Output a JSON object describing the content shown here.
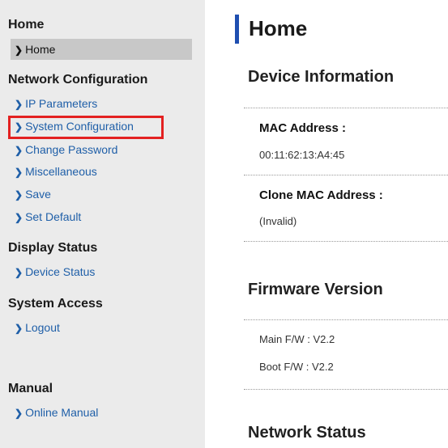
{
  "sidebar": {
    "sections": [
      {
        "title": "Home",
        "items": [
          {
            "label": "Home",
            "selected": true
          }
        ]
      },
      {
        "title": "Network Configuration",
        "items": [
          {
            "label": "IP Parameters"
          },
          {
            "label": "System Configuration",
            "highlighted": true
          },
          {
            "label": "Change Password"
          },
          {
            "label": "Miscellaneous"
          },
          {
            "label": "Save"
          },
          {
            "label": "Set Default"
          }
        ]
      },
      {
        "title": "Display Status",
        "items": [
          {
            "label": "Device Status"
          }
        ]
      },
      {
        "title": "System Access",
        "items": [
          {
            "label": "Logout"
          }
        ]
      },
      {
        "title": "Manual",
        "items": [
          {
            "label": "Online Manual"
          }
        ]
      }
    ]
  },
  "main": {
    "title": "Home",
    "device_info": {
      "heading": "Device Information",
      "mac_label": "MAC Address :",
      "mac_value": "00:11:62:13:A4:45",
      "clone_label": "Clone MAC Address :",
      "clone_value": "(Invalid)"
    },
    "firmware": {
      "heading": "Firmware Version",
      "main": "Main F/W : V2.2",
      "boot": "Boot F/W : V2.2"
    },
    "network": {
      "heading": "Network Status"
    }
  },
  "colors": {
    "link": "#1f5fa8",
    "highlight_box": "#e32121",
    "title_bar": "#1f4fb0",
    "sidebar_bg": "#ebebeb",
    "selected_bg": "#c8c8c8"
  }
}
